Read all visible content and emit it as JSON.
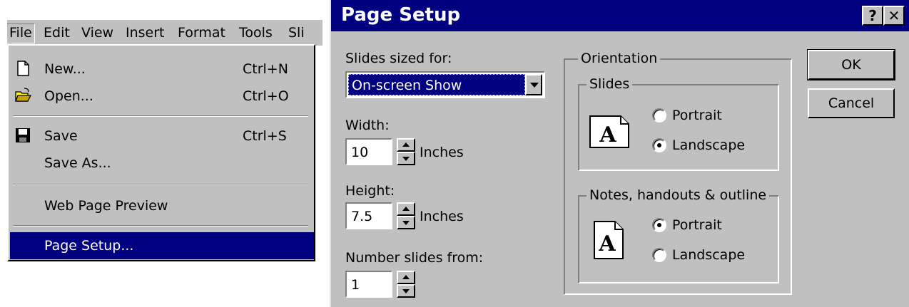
{
  "menubar": {
    "items": [
      "File",
      "Edit",
      "View",
      "Insert",
      "Format",
      "Tools",
      "Sli"
    ]
  },
  "file_menu": {
    "new_label": "New...",
    "new_shortcut": "Ctrl+N",
    "open_label": "Open...",
    "open_shortcut": "Ctrl+O",
    "save_label": "Save",
    "save_shortcut": "Ctrl+S",
    "save_as_label": "Save As...",
    "web_preview_label": "Web Page Preview",
    "page_setup_label": "Page Setup..."
  },
  "dialog": {
    "title": "Page Setup",
    "help_button": "?",
    "close_button": "✕",
    "slides_sized_for_label": "Slides sized for:",
    "slides_sized_for_value": "On-screen Show",
    "width_label": "Width:",
    "width_value": "10",
    "width_unit": "Inches",
    "height_label": "Height:",
    "height_value": "7.5",
    "height_unit": "Inches",
    "number_from_label": "Number slides from:",
    "number_from_value": "1",
    "orientation_label": "Orientation",
    "slides_group_label": "Slides",
    "slides_portrait": "Portrait",
    "slides_landscape": "Landscape",
    "slides_selected": "landscape",
    "notes_group_label": "Notes, handouts & outline",
    "notes_portrait": "Portrait",
    "notes_landscape": "Landscape",
    "notes_selected": "portrait",
    "page_icon_letter": "A",
    "ok_label": "OK",
    "cancel_label": "Cancel"
  },
  "colors": {
    "face": "#c0c0c0",
    "titlebar": "#000080",
    "highlight": "#000080"
  }
}
